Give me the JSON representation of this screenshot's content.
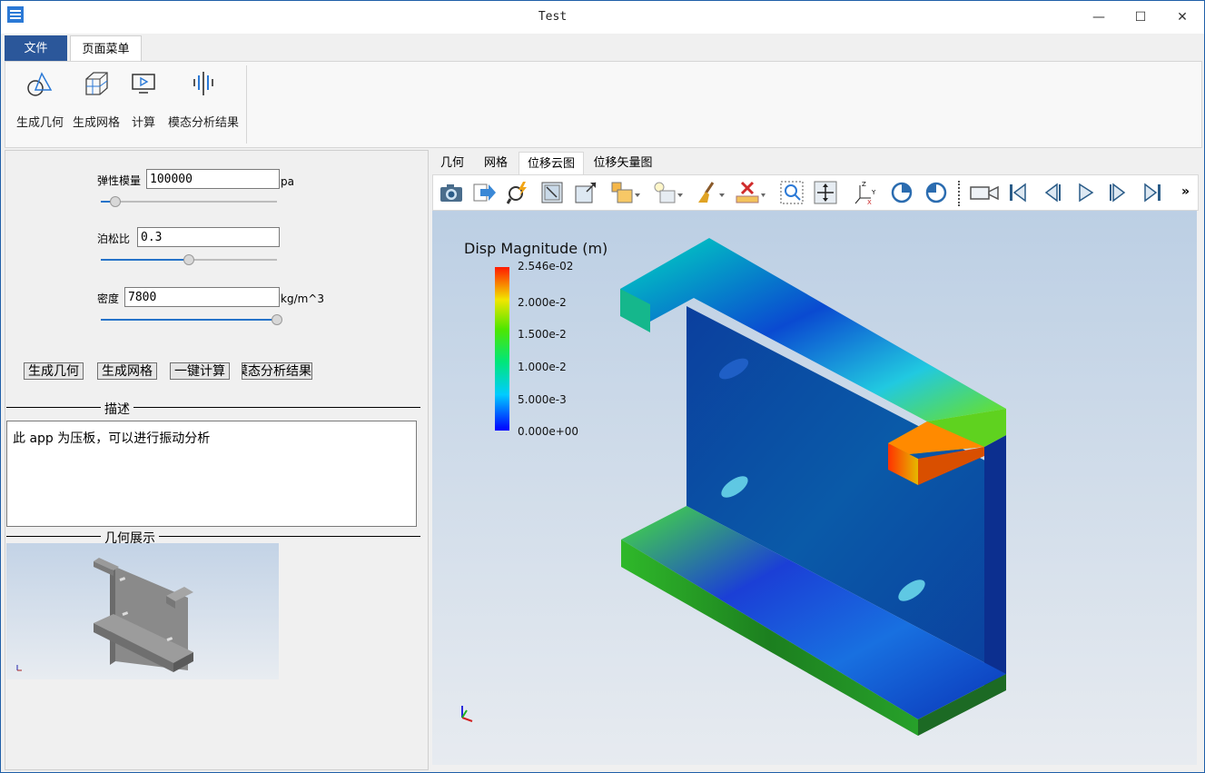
{
  "window": {
    "title": "Test",
    "minimize": "—",
    "maximize": "☐",
    "close": "✕"
  },
  "ribbon": {
    "tabs": [
      "文件",
      "页面菜单"
    ],
    "buttons": [
      {
        "label": "生成几何",
        "icon": "geometry-icon"
      },
      {
        "label": "生成网格",
        "icon": "mesh-icon"
      },
      {
        "label": "计算",
        "icon": "compute-icon"
      },
      {
        "label": "模态分析结果",
        "icon": "modal-result-icon"
      }
    ]
  },
  "params": {
    "modulus": {
      "label": "弹性模量",
      "value": "100000",
      "unit": "pa",
      "slider": 0.08
    },
    "poisson": {
      "label": "泊松比",
      "value": "0.3",
      "unit": "",
      "slider": 0.5
    },
    "density": {
      "label": "密度",
      "value": "7800",
      "unit": "kg/m^3",
      "slider": 1.0
    }
  },
  "actions": [
    "生成几何",
    "生成网格",
    "一键计算",
    "模态分析结果"
  ],
  "description": {
    "header": "描述",
    "text": "此 app 为压板，可以进行振动分析"
  },
  "preview": {
    "header": "几何展示"
  },
  "view_tabs": [
    "几何",
    "网格",
    "位移云图",
    "位移矢量图"
  ],
  "active_view_tab": "位移云图",
  "toolbar_more": "»",
  "legend": {
    "title": "Disp Magnitude (m)",
    "ticks": [
      "2.546e-02",
      "2.000e-2",
      "1.500e-2",
      "1.000e-2",
      "5.000e-3",
      "0.000e+00"
    ]
  },
  "colors": {
    "accent": "#2b579a",
    "slider": "#2673c9"
  }
}
